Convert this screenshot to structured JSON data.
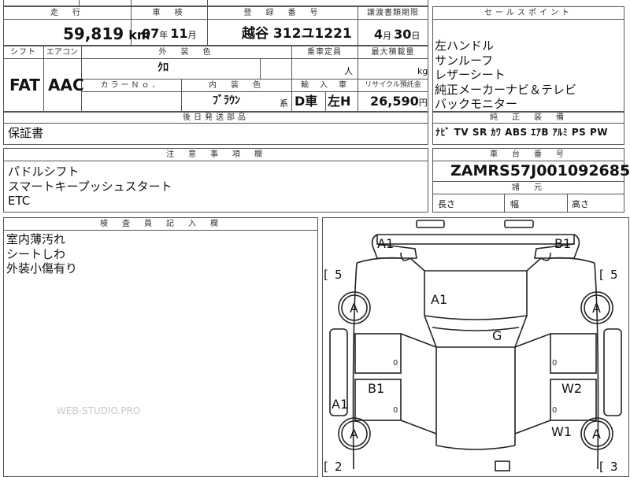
{
  "headers": {
    "mileage": "走　行",
    "inspection": "車　検",
    "registration": "登　録　番　号",
    "transfer_deadline": "譲渡書類期限",
    "sales_point": "セールスポイント",
    "shift": "シフト",
    "aircon": "エアコン",
    "exterior_color": "外　装　色",
    "capacity": "乗車定員",
    "max_load": "最大積載量",
    "color_no": "カラーＮｏ．",
    "interior_color": "内　装　色",
    "import": "輸　入　車",
    "recycle": "リサイクル預託金",
    "later_parts": "後日発送部品",
    "genuine_equipment": "純　正　装　備",
    "notes": "注　意　事　項　欄",
    "chassis_no": "車　台　番　号",
    "dimensions": "諸　元",
    "inspector": "検　査　員　記　入　欄"
  },
  "mileage": {
    "value": "59,819",
    "unit": "km"
  },
  "inspection": {
    "year": "07",
    "year_unit": "年",
    "month": "11",
    "month_unit": "月"
  },
  "registration": {
    "plate": "越谷 312ユ1221"
  },
  "transfer": {
    "month": "4",
    "month_unit": "月",
    "day": "30",
    "day_unit": "日"
  },
  "shift": "FAT",
  "aircon": "AAC",
  "exterior_color": "ｸﾛ",
  "capacity_unit": "人",
  "max_load_unit": "kg",
  "interior_color": "ﾌﾞﾗｳﾝ",
  "interior_suffix": "系",
  "import": {
    "drive": "D車",
    "handle": "左H"
  },
  "recycle": {
    "value": "26,590",
    "unit": "円"
  },
  "sales_points": [
    "左ハンドル",
    "サンルーフ",
    "レザーシート",
    "純正メーカーナビ＆テレビ",
    "バックモニター"
  ],
  "later_parts": "保証書",
  "genuine_equipment": "ﾅﾋﾞ TV SR ｶﾜ ABS ｴｱB ｱﾙﾐ PS PW",
  "notes": [
    "パドルシフト",
    "スマートキープッシュスタート",
    "ETC"
  ],
  "chassis_no": "ZAMRS57J001092685",
  "dims": {
    "length": "長さ",
    "width": "幅",
    "height": "高さ"
  },
  "inspector_notes": [
    "室内薄汚れ",
    "シートしわ",
    "外装小傷有り"
  ],
  "watermark": "WEB-STUDIO.PRO",
  "diagram": {
    "marks": {
      "a1_front_left": "A1",
      "b1_front_right": "B1",
      "a1_hood": "A1",
      "g_windshield": "G",
      "b1_door": "B1",
      "w2_door": "W2",
      "w1_door": "W1",
      "a1_side": "A1",
      "tire_fl": "A",
      "tire_fr": "A",
      "tire_rl": "A",
      "tire_rr": "A"
    },
    "tread": {
      "fl": "5",
      "fr": "5",
      "rl": "2",
      "rr": "3"
    },
    "bracket_open": "[",
    "door_mark": "0"
  }
}
